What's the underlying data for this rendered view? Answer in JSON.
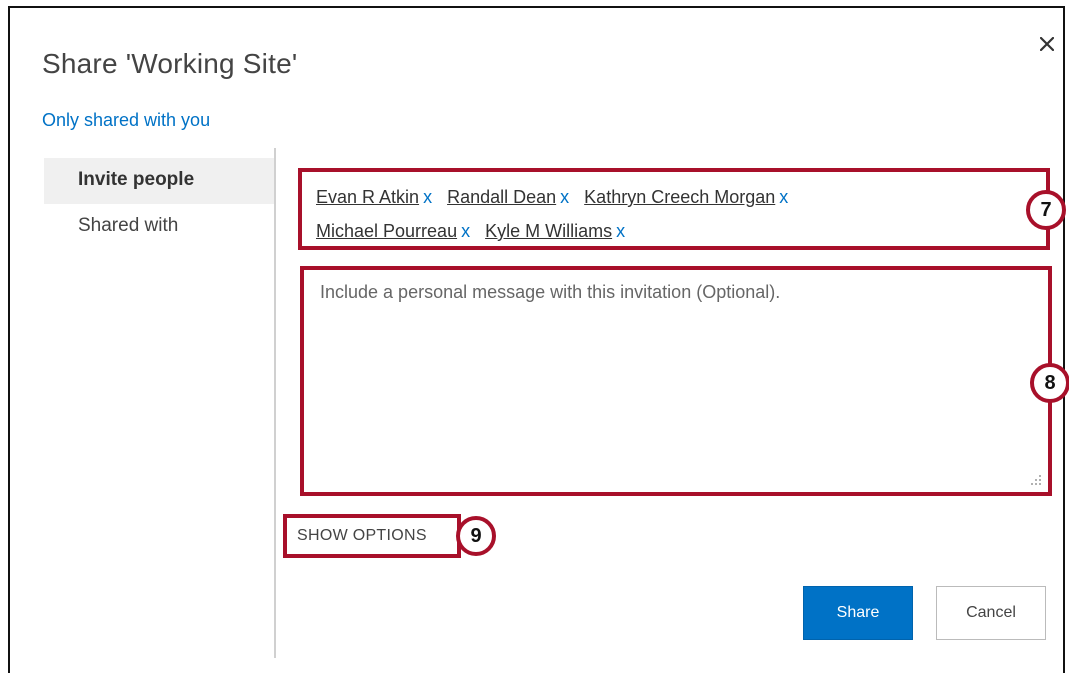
{
  "dialog": {
    "title": "Share 'Working Site'",
    "shared_status": "Only shared with you"
  },
  "nav": {
    "items": [
      {
        "label": "Invite people",
        "active": true
      },
      {
        "label": "Shared with",
        "active": false
      }
    ]
  },
  "invite": {
    "people": [
      {
        "name": "Evan R Atkin",
        "remove": "x"
      },
      {
        "name": "Randall Dean",
        "remove": "x"
      },
      {
        "name": "Kathryn Creech Morgan",
        "remove": "x"
      },
      {
        "name": "Michael Pourreau",
        "remove": "x"
      },
      {
        "name": "Kyle M Williams",
        "remove": "x"
      }
    ],
    "message_placeholder": "Include a personal message with this invitation (Optional).",
    "message_value": "",
    "show_options_label": "SHOW OPTIONS"
  },
  "buttons": {
    "share_label": "Share",
    "cancel_label": "Cancel"
  },
  "callouts": {
    "people_box": "7",
    "message_box": "8",
    "show_options": "9"
  },
  "colors": {
    "accent": "#0072c6",
    "callout_border": "#a8102a"
  },
  "icons": {
    "close": "close-icon",
    "resize": "resize-grip-icon"
  }
}
